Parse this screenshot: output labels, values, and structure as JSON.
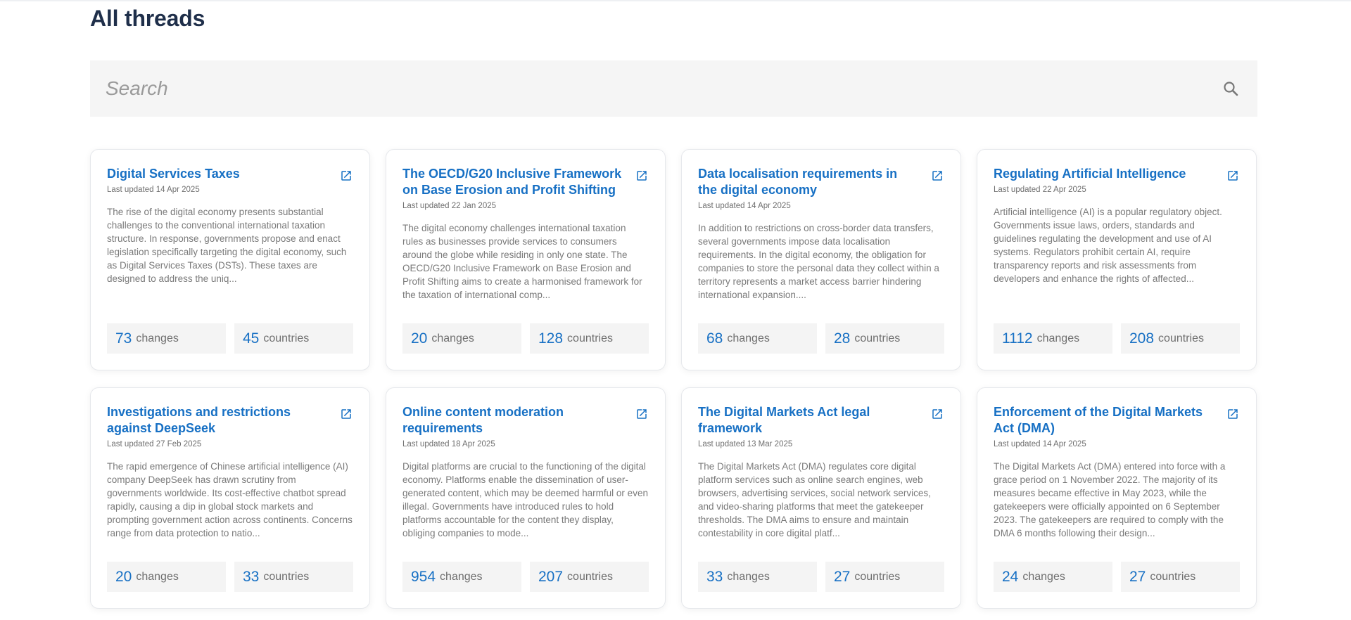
{
  "page": {
    "title": "All threads"
  },
  "search": {
    "placeholder": "Search"
  },
  "labels": {
    "changes": "changes",
    "countries": "countries"
  },
  "cards": [
    {
      "title": "Digital Services Taxes",
      "updated": "Last updated 14 Apr 2025",
      "description": "The rise of the digital economy presents substantial challenges to the conventional international taxation structure. In response, governments propose and enact legislation specifically targeting the digital economy, such as Digital Services Taxes (DSTs). These taxes are designed to address the uniq...",
      "changes": "73",
      "countries": "45"
    },
    {
      "title": "The OECD/G20 Inclusive Framework on Base Erosion and Profit Shifting",
      "updated": "Last updated 22 Jan 2025",
      "description": "The digital economy challenges international taxation rules as businesses provide services to consumers around the globe while residing in only one state. The OECD/G20 Inclusive Framework on Base Erosion and Profit Shifting aims to create a harmonised framework for the taxation of international comp...",
      "changes": "20",
      "countries": "128"
    },
    {
      "title": "Data localisation requirements in the digital economy",
      "updated": "Last updated 14 Apr 2025",
      "description": "In addition to restrictions on cross-border data transfers, several governments impose data localisation requirements. In the digital economy, the obligation for companies to store the personal data they collect within a territory represents a market access barrier hindering international expansion....",
      "changes": "68",
      "countries": "28"
    },
    {
      "title": "Regulating Artificial Intelligence",
      "updated": "Last updated 22 Apr 2025",
      "description": "Artificial intelligence (AI) is a popular regulatory object. Governments issue laws, orders, standards and guidelines regulating the development and use of AI systems. Regulators prohibit certain AI, require transparency reports and risk assessments from developers and enhance the rights of affected...",
      "changes": "1112",
      "countries": "208"
    },
    {
      "title": "Investigations and restrictions against DeepSeek",
      "updated": "Last updated 27 Feb 2025",
      "description": "The rapid emergence of Chinese artificial intelligence (AI) company DeepSeek has drawn scrutiny from governments worldwide. Its cost-effective chatbot spread rapidly, causing a dip in global stock markets and prompting government action across continents. Concerns range from data protection to natio...",
      "changes": "20",
      "countries": "33"
    },
    {
      "title": "Online content moderation requirements",
      "updated": "Last updated 18 Apr 2025",
      "description": "Digital platforms are crucial to the functioning of the digital economy. Platforms enable the dissemination of user-generated content, which may be deemed harmful or even illegal. Governments have introduced rules to hold platforms accountable for the content they display, obliging companies to mode...",
      "changes": "954",
      "countries": "207"
    },
    {
      "title": "The Digital Markets Act legal framework",
      "updated": "Last updated 13 Mar 2025",
      "description": "The Digital Markets Act (DMA) regulates core digital platform services such as online search engines, web browsers, advertising services, social network services, and video-sharing platforms that meet the gatekeeper thresholds. The DMA aims to ensure and maintain contestability in core digital platf...",
      "changes": "33",
      "countries": "27"
    },
    {
      "title": "Enforcement of the Digital Markets Act (DMA)",
      "updated": "Last updated 14 Apr 2025",
      "description": "The Digital Markets Act (DMA) entered into force with a grace period on 1 November 2022. The majority of its measures became effective in May 2023, while the gatekeepers were officially appointed on 6 September 2023. The gatekeepers are required to comply with the DMA 6 months following their design...",
      "changes": "24",
      "countries": "27"
    }
  ]
}
